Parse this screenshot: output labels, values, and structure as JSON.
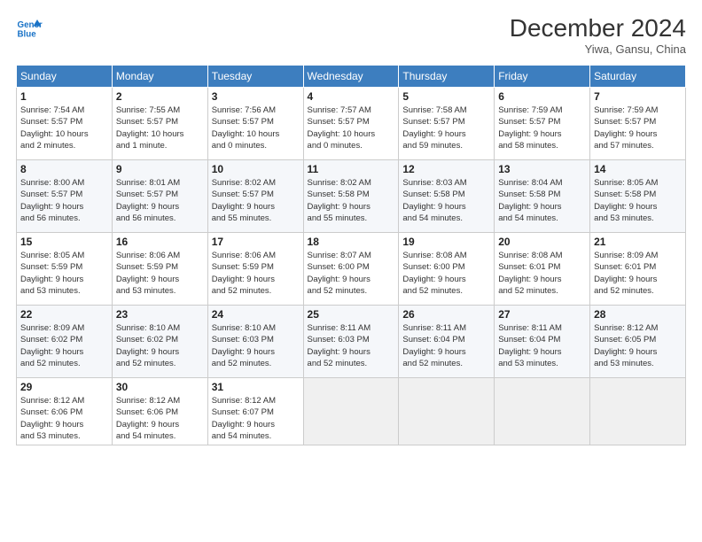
{
  "header": {
    "logo_line1": "General",
    "logo_line2": "Blue",
    "month": "December 2024",
    "location": "Yiwa, Gansu, China"
  },
  "weekdays": [
    "Sunday",
    "Monday",
    "Tuesday",
    "Wednesday",
    "Thursday",
    "Friday",
    "Saturday"
  ],
  "weeks": [
    [
      {
        "day": "1",
        "info": "Sunrise: 7:54 AM\nSunset: 5:57 PM\nDaylight: 10 hours\nand 2 minutes."
      },
      {
        "day": "2",
        "info": "Sunrise: 7:55 AM\nSunset: 5:57 PM\nDaylight: 10 hours\nand 1 minute."
      },
      {
        "day": "3",
        "info": "Sunrise: 7:56 AM\nSunset: 5:57 PM\nDaylight: 10 hours\nand 0 minutes."
      },
      {
        "day": "4",
        "info": "Sunrise: 7:57 AM\nSunset: 5:57 PM\nDaylight: 10 hours\nand 0 minutes."
      },
      {
        "day": "5",
        "info": "Sunrise: 7:58 AM\nSunset: 5:57 PM\nDaylight: 9 hours\nand 59 minutes."
      },
      {
        "day": "6",
        "info": "Sunrise: 7:59 AM\nSunset: 5:57 PM\nDaylight: 9 hours\nand 58 minutes."
      },
      {
        "day": "7",
        "info": "Sunrise: 7:59 AM\nSunset: 5:57 PM\nDaylight: 9 hours\nand 57 minutes."
      }
    ],
    [
      {
        "day": "8",
        "info": "Sunrise: 8:00 AM\nSunset: 5:57 PM\nDaylight: 9 hours\nand 56 minutes."
      },
      {
        "day": "9",
        "info": "Sunrise: 8:01 AM\nSunset: 5:57 PM\nDaylight: 9 hours\nand 56 minutes."
      },
      {
        "day": "10",
        "info": "Sunrise: 8:02 AM\nSunset: 5:57 PM\nDaylight: 9 hours\nand 55 minutes."
      },
      {
        "day": "11",
        "info": "Sunrise: 8:02 AM\nSunset: 5:58 PM\nDaylight: 9 hours\nand 55 minutes."
      },
      {
        "day": "12",
        "info": "Sunrise: 8:03 AM\nSunset: 5:58 PM\nDaylight: 9 hours\nand 54 minutes."
      },
      {
        "day": "13",
        "info": "Sunrise: 8:04 AM\nSunset: 5:58 PM\nDaylight: 9 hours\nand 54 minutes."
      },
      {
        "day": "14",
        "info": "Sunrise: 8:05 AM\nSunset: 5:58 PM\nDaylight: 9 hours\nand 53 minutes."
      }
    ],
    [
      {
        "day": "15",
        "info": "Sunrise: 8:05 AM\nSunset: 5:59 PM\nDaylight: 9 hours\nand 53 minutes."
      },
      {
        "day": "16",
        "info": "Sunrise: 8:06 AM\nSunset: 5:59 PM\nDaylight: 9 hours\nand 53 minutes."
      },
      {
        "day": "17",
        "info": "Sunrise: 8:06 AM\nSunset: 5:59 PM\nDaylight: 9 hours\nand 52 minutes."
      },
      {
        "day": "18",
        "info": "Sunrise: 8:07 AM\nSunset: 6:00 PM\nDaylight: 9 hours\nand 52 minutes."
      },
      {
        "day": "19",
        "info": "Sunrise: 8:08 AM\nSunset: 6:00 PM\nDaylight: 9 hours\nand 52 minutes."
      },
      {
        "day": "20",
        "info": "Sunrise: 8:08 AM\nSunset: 6:01 PM\nDaylight: 9 hours\nand 52 minutes."
      },
      {
        "day": "21",
        "info": "Sunrise: 8:09 AM\nSunset: 6:01 PM\nDaylight: 9 hours\nand 52 minutes."
      }
    ],
    [
      {
        "day": "22",
        "info": "Sunrise: 8:09 AM\nSunset: 6:02 PM\nDaylight: 9 hours\nand 52 minutes."
      },
      {
        "day": "23",
        "info": "Sunrise: 8:10 AM\nSunset: 6:02 PM\nDaylight: 9 hours\nand 52 minutes."
      },
      {
        "day": "24",
        "info": "Sunrise: 8:10 AM\nSunset: 6:03 PM\nDaylight: 9 hours\nand 52 minutes."
      },
      {
        "day": "25",
        "info": "Sunrise: 8:11 AM\nSunset: 6:03 PM\nDaylight: 9 hours\nand 52 minutes."
      },
      {
        "day": "26",
        "info": "Sunrise: 8:11 AM\nSunset: 6:04 PM\nDaylight: 9 hours\nand 52 minutes."
      },
      {
        "day": "27",
        "info": "Sunrise: 8:11 AM\nSunset: 6:04 PM\nDaylight: 9 hours\nand 53 minutes."
      },
      {
        "day": "28",
        "info": "Sunrise: 8:12 AM\nSunset: 6:05 PM\nDaylight: 9 hours\nand 53 minutes."
      }
    ],
    [
      {
        "day": "29",
        "info": "Sunrise: 8:12 AM\nSunset: 6:06 PM\nDaylight: 9 hours\nand 53 minutes."
      },
      {
        "day": "30",
        "info": "Sunrise: 8:12 AM\nSunset: 6:06 PM\nDaylight: 9 hours\nand 54 minutes."
      },
      {
        "day": "31",
        "info": "Sunrise: 8:12 AM\nSunset: 6:07 PM\nDaylight: 9 hours\nand 54 minutes."
      },
      {
        "day": "",
        "info": ""
      },
      {
        "day": "",
        "info": ""
      },
      {
        "day": "",
        "info": ""
      },
      {
        "day": "",
        "info": ""
      }
    ]
  ]
}
